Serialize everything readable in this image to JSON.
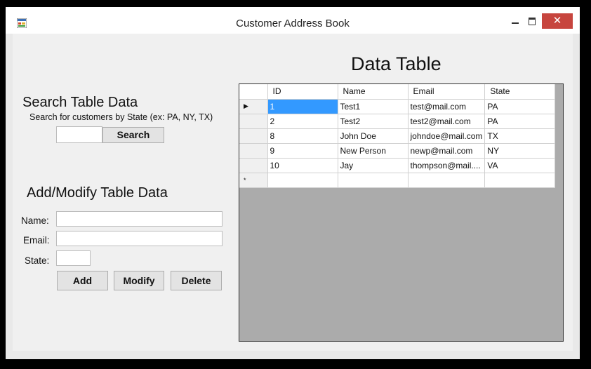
{
  "window": {
    "title": "Customer Address Book",
    "close_glyph": "✕"
  },
  "search": {
    "heading": "Search Table Data",
    "hint": "Search for customers by State (ex: PA, NY, TX)",
    "input_value": "",
    "button_label": "Search"
  },
  "edit": {
    "heading": "Add/Modify Table Data",
    "name_label": "Name:",
    "email_label": "Email:",
    "state_label": "State:",
    "name_value": "",
    "email_value": "",
    "state_value": "",
    "add_label": "Add",
    "modify_label": "Modify",
    "delete_label": "Delete"
  },
  "table": {
    "heading": "Data Table",
    "columns": [
      "ID",
      "Name",
      "Email",
      "State"
    ],
    "rows": [
      {
        "id": "1",
        "name": "Test1",
        "email": "test@mail.com",
        "state": "PA",
        "selected": true
      },
      {
        "id": "2",
        "name": "Test2",
        "email": "test2@mail.com",
        "state": "PA"
      },
      {
        "id": "8",
        "name": "John Doe",
        "email": "johndoe@mail.com",
        "state": "TX"
      },
      {
        "id": "9",
        "name": "New Person",
        "email": "newp@mail.com",
        "state": "NY"
      },
      {
        "id": "10",
        "name": "Jay",
        "email": "thompson@mail....",
        "state": "VA"
      }
    ],
    "current_row_marker": "▶",
    "new_row_marker": "*"
  },
  "colors": {
    "selection": "#3399ff",
    "close_button": "#c7453e",
    "grid_background": "#ababab"
  }
}
